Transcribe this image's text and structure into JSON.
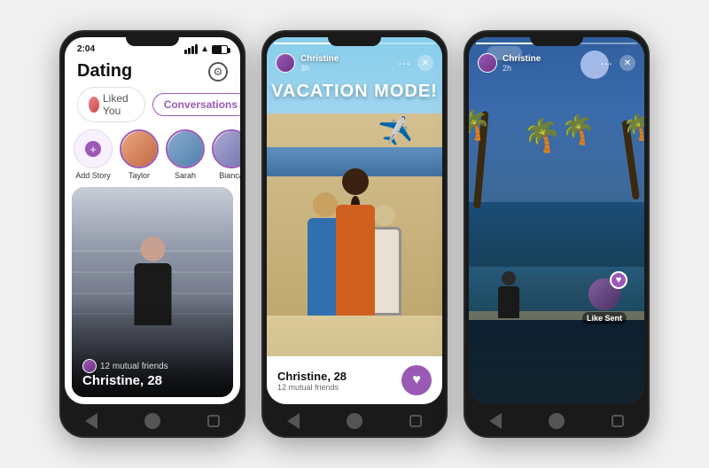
{
  "phones": [
    {
      "id": "phone1",
      "type": "dating-home",
      "status_time": "2:04",
      "title": "Dating",
      "tabs": {
        "liked_you": "Liked You",
        "conversations": "Conversations"
      },
      "stories": [
        {
          "label": "Add Story",
          "type": "add"
        },
        {
          "label": "Taylor",
          "type": "avatar",
          "color": "color1"
        },
        {
          "label": "Sarah",
          "type": "avatar",
          "color": "color2"
        },
        {
          "label": "Bianca",
          "type": "avatar",
          "color": "color3"
        }
      ],
      "card": {
        "name": "Christine, 28",
        "mutual_friends": "12 mutual friends"
      }
    },
    {
      "id": "phone2",
      "type": "story-beach",
      "story_user": "Christine",
      "story_time": "3h",
      "vacation_text": "VACATION MODE!",
      "card": {
        "name": "Christine, 28",
        "mutual_friends": "12 mutual friends"
      }
    },
    {
      "id": "phone3",
      "type": "story-pool",
      "story_user": "Christine",
      "story_time": "2h",
      "like_sent_text": "Like Sent"
    }
  ],
  "icons": {
    "gear": "⚙",
    "plus": "+",
    "heart": "♥",
    "close": "✕",
    "more": "···",
    "airplane": "✈️",
    "heart_purple": "♥",
    "back_arrow": "◁",
    "home_circle": "●",
    "square": "▢"
  }
}
